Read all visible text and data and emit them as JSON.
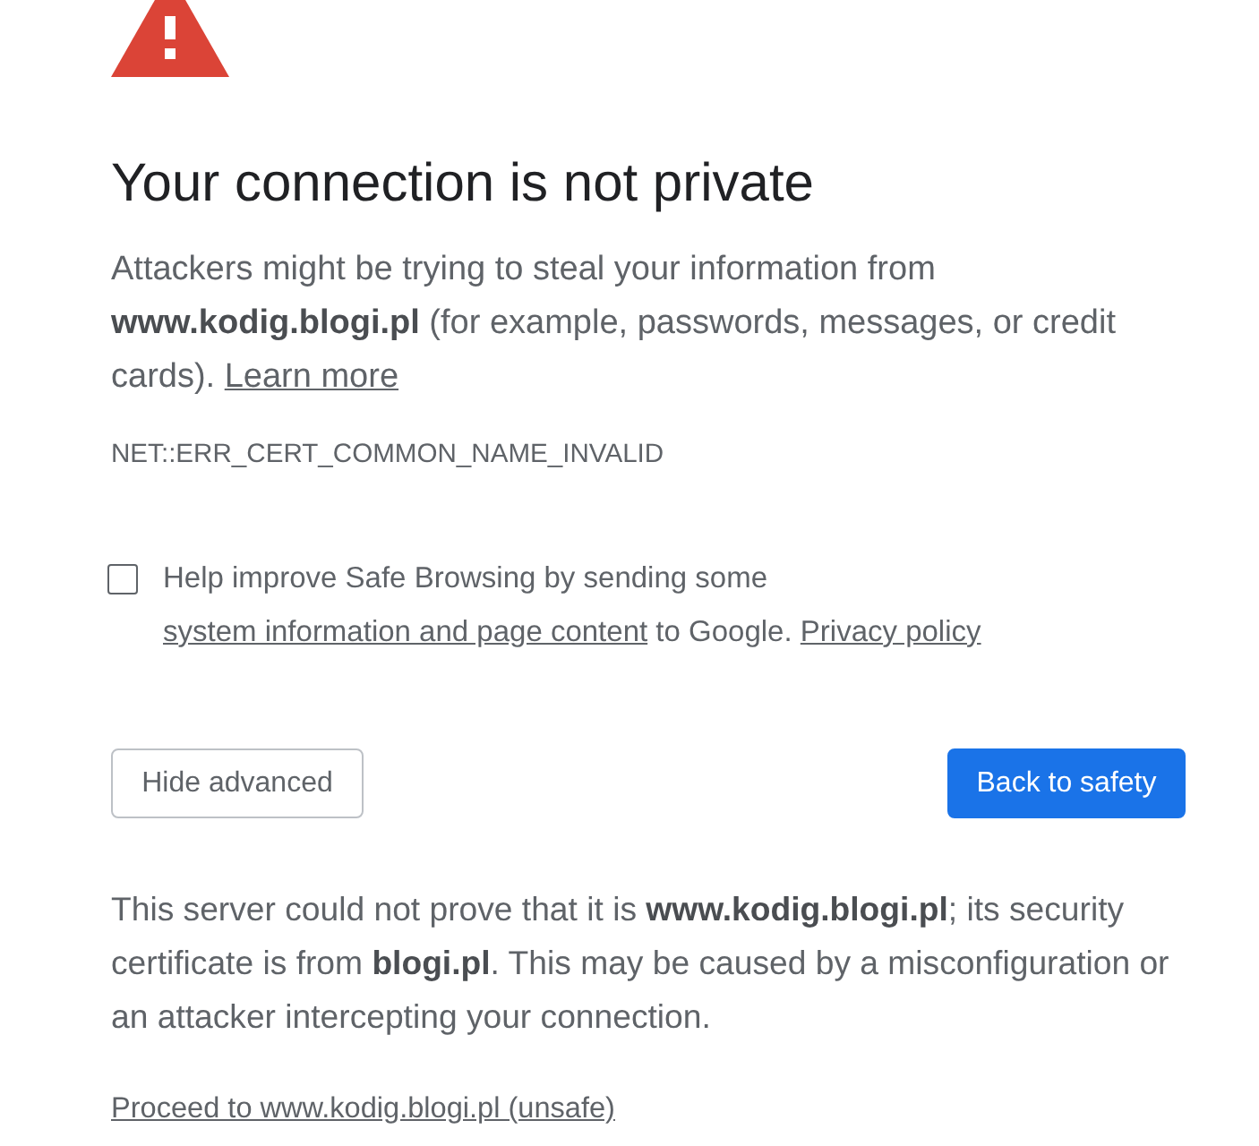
{
  "title": "Your connection is not private",
  "intro": {
    "text": "Attackers might be trying to steal your information from **www.kodig.blogi.pl** (for example, passwords, messages, or credit cards).",
    "link": "Learn more"
  },
  "error_code": "NET::ERR_CERT_COMMON_NAME_INVALID",
  "opt_in": {
    "checked": false,
    "parts": [
      {
        "kind": "text",
        "text": "Help improve Safe Browsing by sending some"
      },
      {
        "kind": "link",
        "text": "system information and page content"
      },
      {
        "kind": "text",
        "text": "to Google."
      },
      {
        "kind": "link",
        "text": "Privacy policy"
      }
    ]
  },
  "buttons": [
    {
      "label": "Hide advanced",
      "kind": "secondary"
    },
    {
      "label": "Back to safety",
      "kind": "primary"
    }
  ],
  "details": "This server could not prove that it is **www.kodig.blogi.pl**; its security certificate is from **blogi.pl**. This may be caused by a misconfiguration or an attacker intercepting your connection.",
  "proceed_link": "Proceed to www.kodig.blogi.pl (unsafe)"
}
